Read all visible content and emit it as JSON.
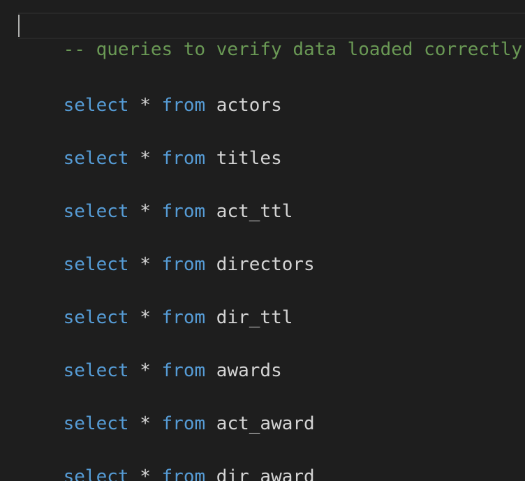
{
  "colors": {
    "background": "#1e1e1e",
    "comment": "#6a9955",
    "keyword": "#569cd6",
    "text": "#d4d4d4",
    "cursor": "#aeafad",
    "current_line_border": "#282828"
  },
  "editor": {
    "comment_line": "-- queries to verify data loaded correctly",
    "lines": [
      {
        "kw1": "select",
        "op": "*",
        "kw2": "from",
        "table": "actors"
      },
      {
        "kw1": "select",
        "op": "*",
        "kw2": "from",
        "table": "titles"
      },
      {
        "kw1": "select",
        "op": "*",
        "kw2": "from",
        "table": "act_ttl"
      },
      {
        "kw1": "select",
        "op": "*",
        "kw2": "from",
        "table": "directors"
      },
      {
        "kw1": "select",
        "op": "*",
        "kw2": "from",
        "table": "dir_ttl"
      },
      {
        "kw1": "select",
        "op": "*",
        "kw2": "from",
        "table": "awards"
      },
      {
        "kw1": "select",
        "op": "*",
        "kw2": "from",
        "table": "act_award"
      },
      {
        "kw1": "select",
        "op": "*",
        "kw2": "from",
        "table": "dir_award"
      }
    ]
  }
}
